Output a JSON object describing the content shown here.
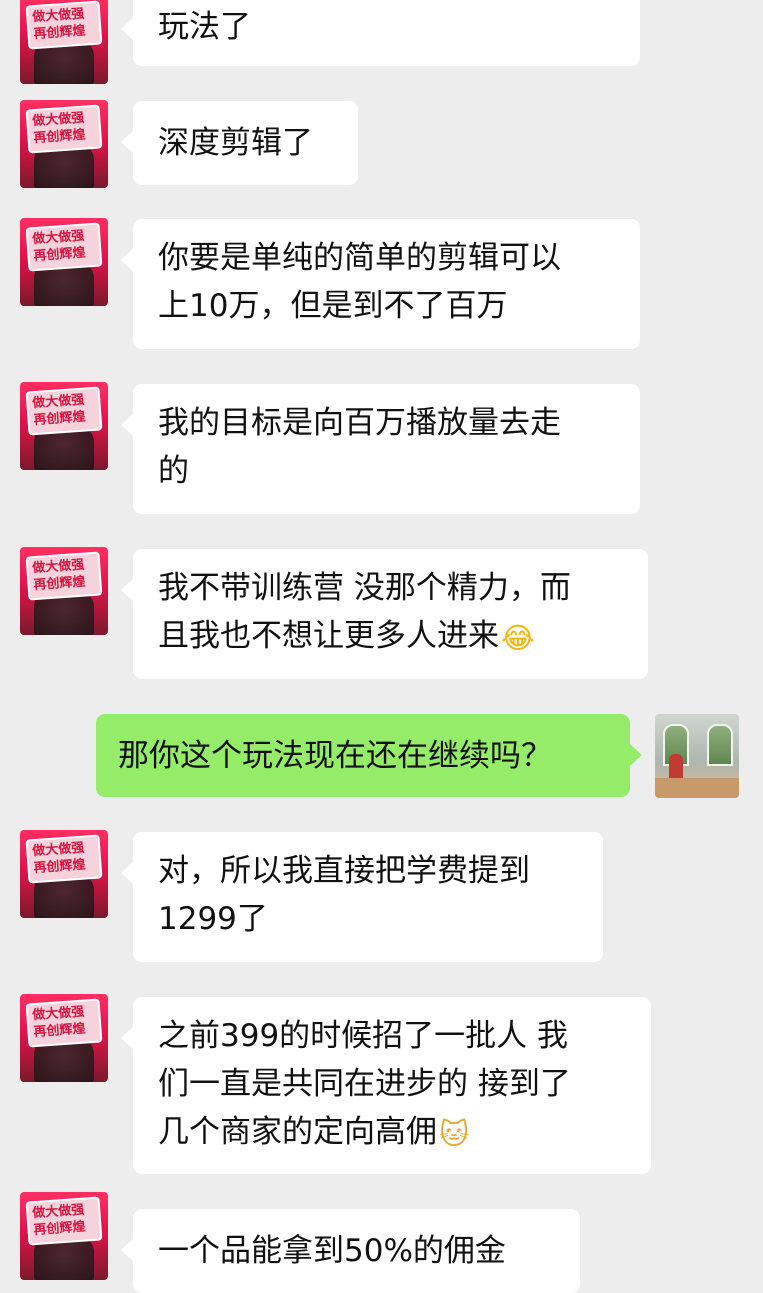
{
  "chat": {
    "messages": [
      {
        "side": "in",
        "lines": [
          "玩法了"
        ]
      },
      {
        "side": "in",
        "lines": [
          "深度剪辑了"
        ]
      },
      {
        "side": "in",
        "lines": [
          "你要是单纯的简单的剪辑可以",
          "上10万，但是到不了百万"
        ]
      },
      {
        "side": "in",
        "lines": [
          "我的目标是向百万播放量去走",
          "的"
        ]
      },
      {
        "side": "in",
        "lines": [
          "我不带训练营 没那个精力，而",
          "且我也不想让更多人进来"
        ],
        "emoji": "😂"
      },
      {
        "side": "out",
        "lines": [
          "那你这个玩法现在还在继续吗？"
        ]
      },
      {
        "side": "in",
        "lines": [
          "对，所以我直接把学费提到",
          "1299了"
        ]
      },
      {
        "side": "in",
        "lines": [
          "之前399的时候招了一批人 我",
          "们一直是共同在进步的 接到了",
          "几个商家的定向高佣"
        ],
        "emoji": "🐱"
      },
      {
        "side": "in",
        "lines": [
          "一个品能拿到50%的佣金"
        ]
      }
    ],
    "contact_avatar": {
      "icon": "avatar-red-slogan-icon",
      "badge_text": [
        "做大做强",
        "再创辉煌"
      ]
    },
    "self_avatar": {
      "icon": "avatar-photo-icon"
    },
    "colors": {
      "background": "#ededed",
      "incoming_bubble": "#ffffff",
      "outgoing_bubble": "#95ec69"
    }
  }
}
